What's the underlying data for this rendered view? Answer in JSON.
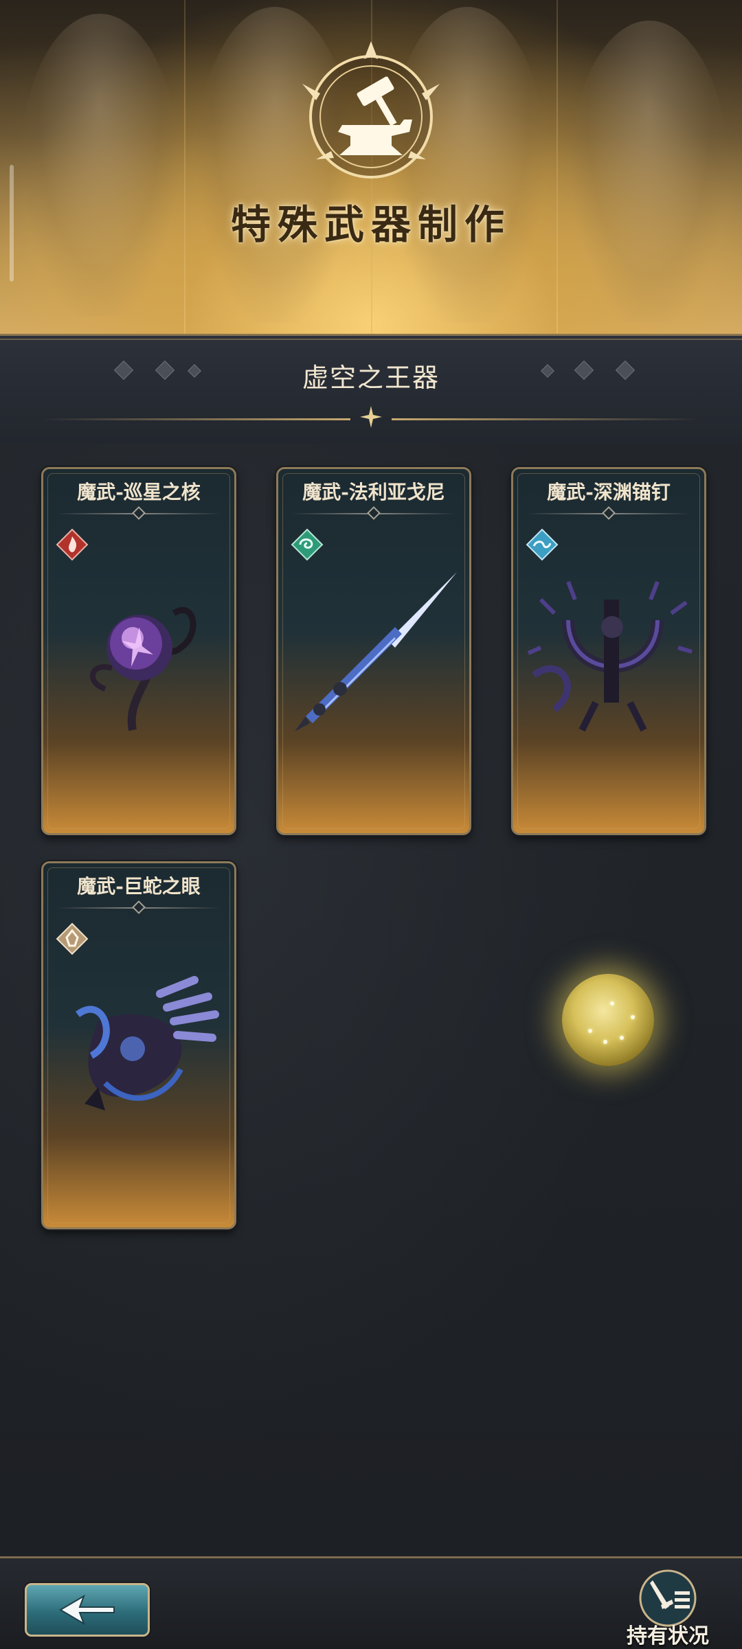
{
  "header": {
    "title": "特殊武器制作",
    "emblem_icon": "anvil-hammer-icon"
  },
  "section": {
    "title": "虚空之王器"
  },
  "weapons": [
    {
      "name": "魔武-巡星之核",
      "element": "fire",
      "element_color": "#b2332c",
      "element_icon": "flame-icon",
      "art": "purple-orb-staff"
    },
    {
      "name": "魔武-法利亚戈尼",
      "element": "wind",
      "element_color": "#2e9b78",
      "element_icon": "swirl-icon",
      "art": "blue-spear"
    },
    {
      "name": "魔武-深渊锚钉",
      "element": "water",
      "element_color": "#3c9ec2",
      "element_icon": "wave-icon",
      "art": "spiked-anchor"
    },
    {
      "name": "魔武-巨蛇之眼",
      "element": "earth",
      "element_color": "#b69a76",
      "element_icon": "crystal-icon",
      "art": "serpent-gauntlet"
    }
  ],
  "footer": {
    "back_icon": "back-arrow-icon",
    "status_label": "持有状况",
    "status_icon": "sword-list-icon"
  },
  "colors": {
    "accent_gold": "#c8aa6e",
    "panel_dark": "#22262b",
    "back_button_teal": "#2d6d7a"
  }
}
